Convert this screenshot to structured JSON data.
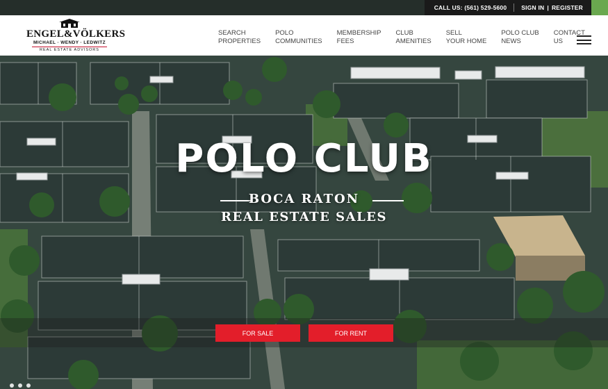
{
  "topbar": {
    "call_label": "CALL US: (561) 529-5600",
    "sign_in": "SIGN IN",
    "divider": "|",
    "register": "REGISTER"
  },
  "logo": {
    "brand": "ENGEL&VÖLKERS",
    "names": "MICHAEL · WENDY · LEDWITZ",
    "tagline": "REAL ESTATE ADVISORS"
  },
  "nav": {
    "items": [
      {
        "label": "SEARCH\nPROPERTIES"
      },
      {
        "label": "POLO\nCOMMUNITIES"
      },
      {
        "label": "MEMBERSHIP\nFEES"
      },
      {
        "label": "CLUB\nAMENITIES"
      },
      {
        "label": "SELL\nYOUR HOME"
      },
      {
        "label": "POLO CLUB\nNEWS"
      },
      {
        "label": "CONTACT\nUS"
      }
    ]
  },
  "hero": {
    "title": "POLO CLUB",
    "subtitle1": "BOCA RATON",
    "subtitle2": "REAL ESTATE SALES"
  },
  "cta": {
    "for_sale": "FOR SALE",
    "for_rent": "FOR RENT"
  },
  "colors": {
    "accent_red": "#e31e2a",
    "topbar_bg": "#1a1a1a",
    "corner_green": "#6aa84f"
  },
  "icons": [
    "house-logo-icon",
    "hamburger-menu-icon"
  ]
}
